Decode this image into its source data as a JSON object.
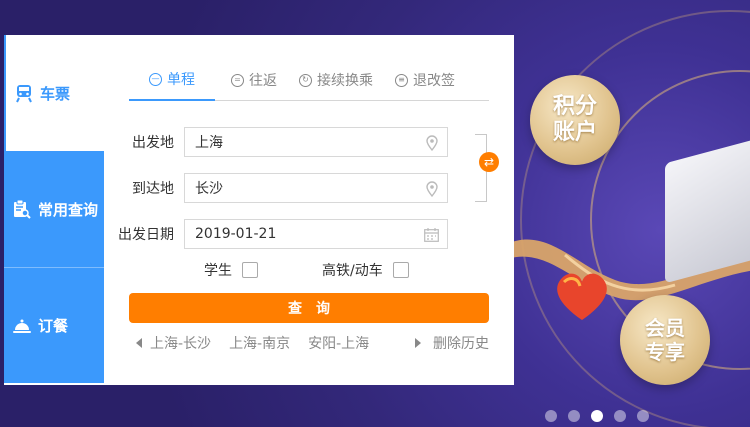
{
  "sidebar": {
    "items": [
      {
        "label": "车票",
        "icon": "train-icon",
        "active": true
      },
      {
        "label": "常用查询",
        "icon": "clipboard-search-icon",
        "active": false
      },
      {
        "label": "订餐",
        "icon": "dish-cover-icon",
        "active": false
      }
    ]
  },
  "tabs": [
    {
      "label": "单程",
      "icon": "minus-circle-icon",
      "active": true
    },
    {
      "label": "往返",
      "icon": "equals-circle-icon",
      "active": false
    },
    {
      "label": "接续换乘",
      "icon": "refresh-circle-icon",
      "active": false
    },
    {
      "label": "退改签",
      "icon": "ticket-circle-icon",
      "active": false
    }
  ],
  "form": {
    "from_label": "出发地",
    "from_value": "上海",
    "to_label": "到达地",
    "to_value": "长沙",
    "date_label": "出发日期",
    "date_value": "2019-01-21",
    "student_label": "学生",
    "highspeed_label": "高铁/动车",
    "search_label": "查询"
  },
  "history": {
    "items": [
      "上海-长沙",
      "上海-南京",
      "安阳-上海"
    ],
    "clear_label": "删除历史"
  },
  "banner": {
    "points_label_line1": "积分",
    "points_label_line2": "账户",
    "member_label_line1": "会员",
    "member_label_line2": "专享",
    "active_slide": 3,
    "slide_count": 5
  },
  "colors": {
    "accent_blue": "#3b99fc",
    "accent_orange": "#ff7e00",
    "banner_purple": "#3d2f8c"
  }
}
